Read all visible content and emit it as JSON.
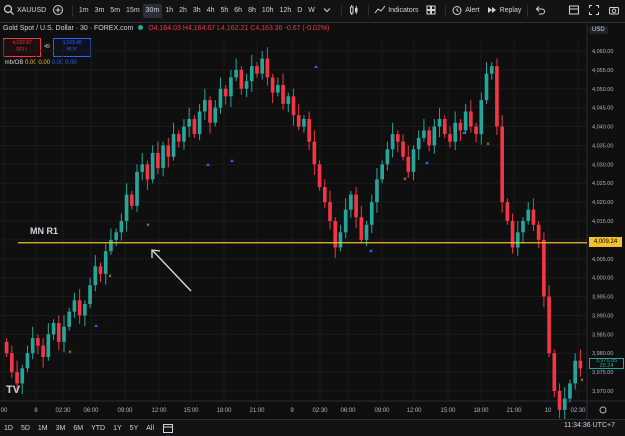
{
  "toolbar": {
    "symbol": "XAUUSD",
    "timeframes": [
      "1m",
      "3m",
      "5m",
      "15m",
      "30m",
      "1h",
      "2h",
      "3h",
      "4h",
      "5h",
      "6h",
      "8h",
      "10h",
      "12h",
      "D",
      "W"
    ],
    "active_timeframe": "30m",
    "indicators_label": "Indicators",
    "alert_label": "Alert",
    "replay_label": "Replay"
  },
  "legend": {
    "title": "Gold Spot / U.S. Dollar · 30 · FOREX.com",
    "open": "O4,164.03",
    "high": "H4,164.67",
    "low": "L4,162.21",
    "close": "C4,163.36",
    "change": "-0.67 (-0.02%)"
  },
  "trade": {
    "sell_price": "4,162.97",
    "sell_label": "SELL",
    "spread": "49",
    "buy_price": "4,163.46",
    "buy_label": "BUY"
  },
  "indicator": {
    "name": "Imb/OB",
    "v1": "0.00",
    "v2": "0.00",
    "v3": "0.00",
    "v4": "0.00"
  },
  "currency": "USD",
  "level": {
    "name": "MN R1",
    "price": "4,009.24",
    "last_price": "3,976.85",
    "countdown": "25:24"
  },
  "price_axis": [
    "4,060.00",
    "4,055.00",
    "4,050.00",
    "4,045.00",
    "4,040.00",
    "4,035.00",
    "4,030.00",
    "4,025.00",
    "4,020.00",
    "4,015.00",
    "4,010.00",
    "4,005.00",
    "4,000.00",
    "3,995.00",
    "3,990.00",
    "3,985.00",
    "3,980.00",
    "3,975.00",
    "3,970.00"
  ],
  "time_axis": [
    "00",
    "8",
    "02:30",
    "06:00",
    "09:00",
    "12:00",
    "15:00",
    "18:00",
    "21:00",
    "9",
    "02:30",
    "06:00",
    "09:00",
    "12:00",
    "15:00",
    "18:00",
    "21:00",
    "10",
    "02:30"
  ],
  "ranges": [
    "1D",
    "5D",
    "1M",
    "3M",
    "6M",
    "YTD",
    "1Y",
    "5Y",
    "All"
  ],
  "clock": "11:34:36 UTC+7",
  "colors": {
    "up": "#26a69a",
    "down": "#f23645",
    "level": "#f2c12e",
    "bg": "#0f0f0f"
  }
}
